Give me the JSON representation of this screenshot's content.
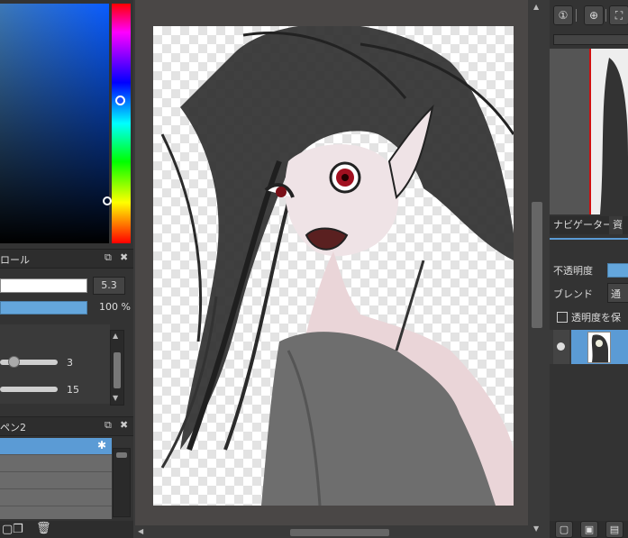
{
  "brush_panel": {
    "title": "ロール",
    "size_value": "5.3",
    "opacity_value": "100 %",
    "slider1_value": "3",
    "slider2_value": "15"
  },
  "layer_panel_left": {
    "title": "ペン2"
  },
  "right_panel": {
    "tabs": [
      "ナビゲーター",
      "資"
    ],
    "opacity_label": "不透明度",
    "blend_label": "ブレンド",
    "blend_value": "通",
    "preserve_opacity_label": "透明度を保"
  }
}
